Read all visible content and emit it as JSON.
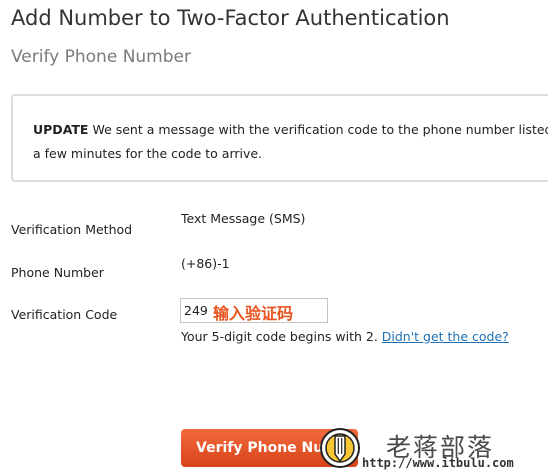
{
  "header": {
    "title": "Add Number to Two-Factor Authentication",
    "subtitle": "Verify Phone Number"
  },
  "notice": {
    "lead": "UPDATE",
    "line1": " We sent a message with the verification code to the phone number listed",
    "line2": "a few minutes for the code to arrive."
  },
  "form": {
    "method": {
      "label": "Verification Method",
      "value": "Text Message (SMS)"
    },
    "phone": {
      "label": "Phone Number",
      "value": "(+86)-1"
    },
    "code": {
      "label": "Verification Code",
      "value": "249",
      "annotation": "输入验证码",
      "hint_prefix": "Your 5-digit code begins with 2. ",
      "hint_link": "Didn't get the code?"
    }
  },
  "actions": {
    "verify_label": "Verify Phone Number"
  },
  "watermark": {
    "name": "老蒋部落",
    "url": "http://www.itbulu.com"
  },
  "colors": {
    "accent": "#e8541e",
    "link": "#1f6fb5",
    "notice_border": "#dcdcdc"
  }
}
